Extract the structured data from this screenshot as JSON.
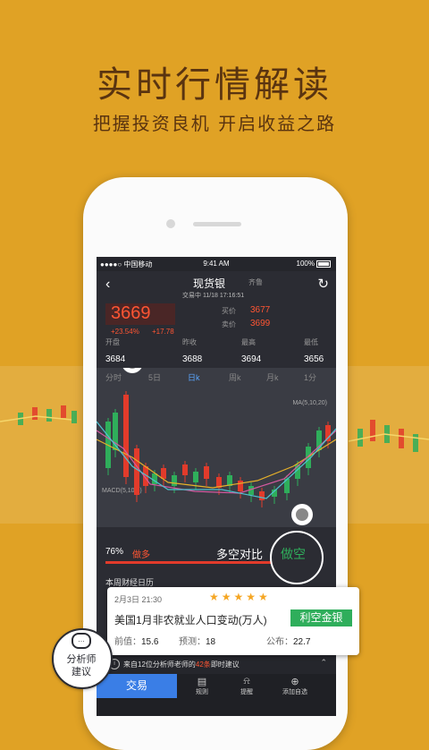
{
  "hero": {
    "title": "实时行情解读",
    "subtitle": "把握投资良机 开启收益之路"
  },
  "statusbar": {
    "carrier": "●●●●○ 中国移动 ",
    "time": "9:41 AM",
    "battery": "100%"
  },
  "nav": {
    "back": "‹",
    "title": "现货银",
    "exchange": "齐鲁",
    "status": "交易中 11/18  17:16:51",
    "refresh": "↻"
  },
  "quote": {
    "price": "3669",
    "change_pct": "+23.54%",
    "change_abs": "+17.78",
    "bid_label": "买价",
    "bid": "3677",
    "ask_label": "卖价",
    "ask": "3699"
  },
  "stats": [
    {
      "label": "开盘",
      "value": "3684"
    },
    {
      "label": "昨收",
      "value": "3688"
    },
    {
      "label": "最高",
      "value": "3694"
    },
    {
      "label": "最低",
      "value": "3656"
    }
  ],
  "periods": [
    "分时",
    "5日",
    "日k",
    "周k",
    "月k",
    "1分"
  ],
  "active_period": "日k",
  "chart": {
    "ma_label": "MA(5,10,20)",
    "macd_label": "MACD(5,10,5)"
  },
  "ratio": {
    "pct": "76%",
    "label": "做多",
    "title": "多空对比",
    "circle": "做空",
    "bull_fraction": 0.76
  },
  "calendar_title": "本周财经日历",
  "card": {
    "date": "2月3日  21:30",
    "stars": "★★★★★",
    "event": "美国1月非农就业人口变动(万人)",
    "badge": "利空金银",
    "prev_label": "前值：",
    "prev": "15.6",
    "forecast_label": "预测：",
    "forecast": "18",
    "actual_label": "公布：",
    "actual": "22.7"
  },
  "bubble": {
    "line1": "分析师",
    "line2": "建议",
    "icon": "…"
  },
  "analyst": {
    "prefix": "来自12位分析师老师的",
    "count": "42条",
    "suffix": "即时建议"
  },
  "bottom_nav": [
    {
      "label": "交易"
    },
    {
      "label": "规则",
      "icon": "▤"
    },
    {
      "label": "提醒",
      "icon": "⍾"
    },
    {
      "label": "添加自选",
      "icon": "⊕"
    }
  ],
  "colors": {
    "background": "#e0a225",
    "up": "#ff5533",
    "down": "#2fae5b",
    "accent": "#3a7ee6"
  }
}
